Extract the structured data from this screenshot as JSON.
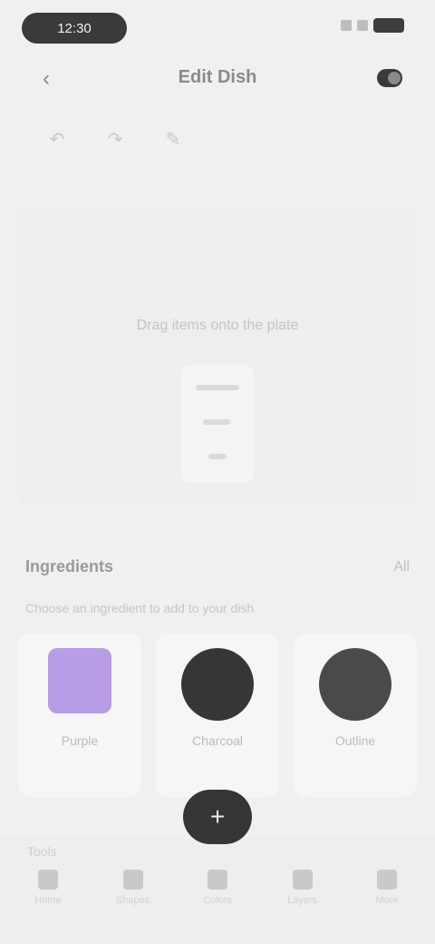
{
  "status": {
    "time": "12:30"
  },
  "header": {
    "title": "Edit Dish",
    "back_icon": "chevron-left-icon",
    "action_icon": "toggle-icon"
  },
  "toolbar": [
    {
      "icon": "undo-icon",
      "glyph": "↶"
    },
    {
      "icon": "redo-icon",
      "glyph": "↷"
    },
    {
      "icon": "brush-icon",
      "glyph": "✎"
    }
  ],
  "canvas": {
    "hint": "Drag items onto the plate"
  },
  "section": {
    "title": "Ingredients",
    "more": "All",
    "subtitle": "Choose an ingredient to add to your dish"
  },
  "cards": [
    {
      "label": "Purple",
      "icon": "color-swatch-icon"
    },
    {
      "label": "Charcoal",
      "icon": "circle-filled-icon"
    },
    {
      "label": "Outline",
      "icon": "circle-outline-icon"
    }
  ],
  "bottom": {
    "label": "Tools",
    "fab": "+",
    "tabs": [
      {
        "label": "Home",
        "icon": "home-icon"
      },
      {
        "label": "Shapes",
        "icon": "shapes-icon"
      },
      {
        "label": "Colors",
        "icon": "palette-icon"
      },
      {
        "label": "Layers",
        "icon": "layers-icon"
      },
      {
        "label": "More",
        "icon": "menu-icon"
      }
    ]
  },
  "colors": {
    "accent": "#b79ce6",
    "dark": "#363636",
    "background": "#eef0f1"
  }
}
